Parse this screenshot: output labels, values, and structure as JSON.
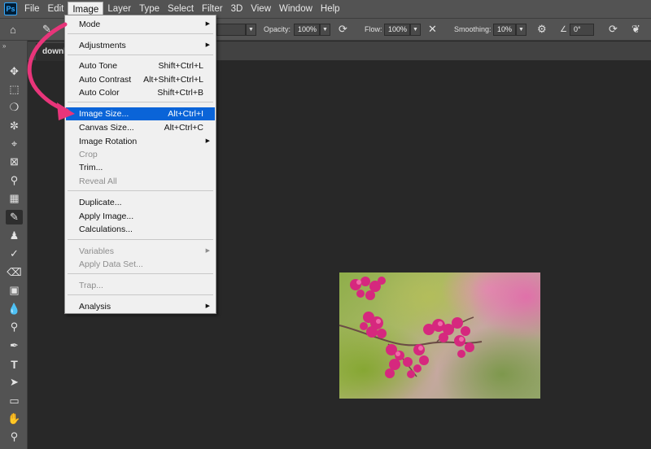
{
  "app": {
    "logo_text": "Ps"
  },
  "menubar": {
    "items": [
      "File",
      "Edit",
      "Image",
      "Layer",
      "Type",
      "Select",
      "Filter",
      "3D",
      "View",
      "Window",
      "Help"
    ],
    "active": "Image"
  },
  "optionsbar": {
    "opacity_label": "Opacity:",
    "opacity_value": "100%",
    "flow_label": "Flow:",
    "flow_value": "100%",
    "smoothing_label": "Smoothing:",
    "smoothing_value": "10%",
    "angle_value": "0°"
  },
  "document": {
    "tab_label": "downlo"
  },
  "image_menu": {
    "mode": "Mode",
    "adjustments": "Adjustments",
    "auto_tone": {
      "label": "Auto Tone",
      "shortcut": "Shift+Ctrl+L"
    },
    "auto_contrast": {
      "label": "Auto Contrast",
      "shortcut": "Alt+Shift+Ctrl+L"
    },
    "auto_color": {
      "label": "Auto Color",
      "shortcut": "Shift+Ctrl+B"
    },
    "image_size": {
      "label": "Image Size...",
      "shortcut": "Alt+Ctrl+I"
    },
    "canvas_size": {
      "label": "Canvas Size...",
      "shortcut": "Alt+Ctrl+C"
    },
    "image_rotation": "Image Rotation",
    "crop": "Crop",
    "trim": "Trim...",
    "reveal_all": "Reveal All",
    "duplicate": "Duplicate...",
    "apply_image": "Apply Image...",
    "calculations": "Calculations...",
    "variables": "Variables",
    "apply_data_set": "Apply Data Set...",
    "trap": "Trap...",
    "analysis": "Analysis"
  },
  "colors": {
    "highlight": "#0a64d8",
    "annotation_arrow": "#e8357a",
    "ps_blue": "#31a8ff"
  },
  "icons": {
    "home": "home-icon",
    "brush": "brush-icon",
    "pressure": "pressure-opacity-icon",
    "airbrush": "airbrush-icon",
    "settings": "gear-icon",
    "angle": "angle-icon",
    "symmetry": "butterfly-icon"
  }
}
